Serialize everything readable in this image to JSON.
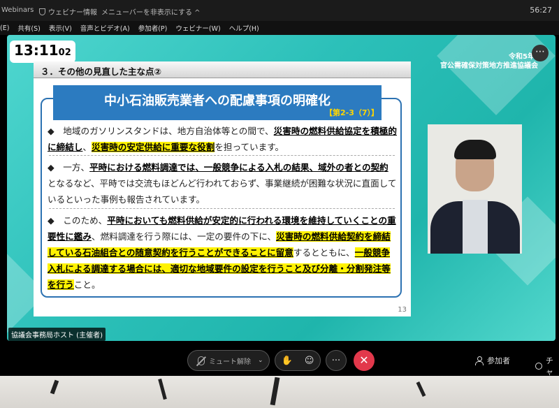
{
  "titlebar": {
    "app_name": "Webinars",
    "info_label": "ウェビナー情報",
    "hide_menu_label": "メニューバーを非表示にする ^",
    "clock": "56:27"
  },
  "menubar": {
    "items": [
      "(E)",
      "共有(S)",
      "表示(V)",
      "音声とビデオ(A)",
      "参加者(P)",
      "ウェビナー(W)",
      "ヘルプ(H)"
    ]
  },
  "meeting": {
    "timer_main": "13:11",
    "timer_sec": "02",
    "org_date": "令和5年",
    "org_name": "官公需確保対策地方推進協議会",
    "more_icon": "more-dots-icon",
    "host_label": "協議会事務局ホスト (主催者)"
  },
  "slide": {
    "header": "３．その他の見直した主な点②",
    "banner_title": "中小石油販売業者への配慮事項の明確化",
    "banner_ref": "【第2-3（7）】",
    "page_number": "13",
    "para1": {
      "bullet": "◆",
      "t1": "　地域のガソリンスタンドは、地方自治体等との間で、",
      "u1": "災害時の燃料供給協定を積極的に締結し",
      "t2": "、",
      "u2": "災害時の安定供給に重要な役割",
      "t3": "を担っています。"
    },
    "para2": {
      "bullet": "◆",
      "t1": "　一方、",
      "u1": "平時における燃料調達では、一般競争による入札の結果、域外の者との契約",
      "t2": "となるなど、平時では交流もほどんど行われておらず、事業継続が困難な状況に直面しているといった事例も報告されています。"
    },
    "para3": {
      "bullet": "◆",
      "t1": "　このため、",
      "u1": "平時においても燃料供給が安定的に行われる環境を維持していくことの重要性に鑑み",
      "t2": "、燃料調達を行う際には、一定の要件の下に、",
      "u2": "災害時の燃料供給契約を締結している石油組合との随意契約を行うことができることに留意",
      "t3": "するとともに、",
      "u3": "一般競争入札による調達する場合には、適切な地域要件の設定を行うこと及び分離・分割発注等を行う",
      "t4": "こと。"
    }
  },
  "controls": {
    "mute_label": "ミュート解除",
    "mute_icon": "mic-off-icon",
    "raise_hand_icon": "raise-hand-icon",
    "reaction_icon": "emoji-icon",
    "more_label": "···",
    "leave_label": "✕",
    "participants_label": "参加者",
    "chat_label": "チャ"
  }
}
